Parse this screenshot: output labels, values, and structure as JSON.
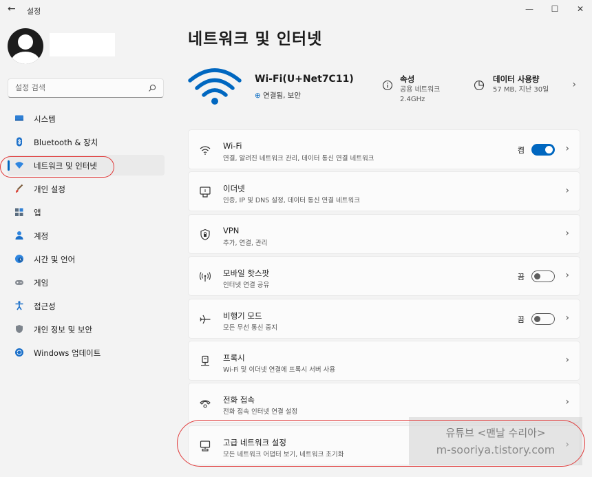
{
  "window": {
    "title": "설정",
    "back_icon": "←",
    "minimize": "—",
    "maximize": "☐",
    "close": "✕"
  },
  "search": {
    "placeholder": "설정 검색"
  },
  "sidebar": {
    "items": [
      {
        "label": "시스템",
        "icon": "monitor-icon"
      },
      {
        "label": "Bluetooth & 장치",
        "icon": "bluetooth-icon"
      },
      {
        "label": "네트워크 및 인터넷",
        "icon": "network-icon",
        "selected": true
      },
      {
        "label": "개인 설정",
        "icon": "brush-icon"
      },
      {
        "label": "앱",
        "icon": "apps-icon"
      },
      {
        "label": "계정",
        "icon": "account-icon"
      },
      {
        "label": "시간 및 언어",
        "icon": "globe-clock-icon"
      },
      {
        "label": "게임",
        "icon": "gamepad-icon"
      },
      {
        "label": "접근성",
        "icon": "accessibility-icon"
      },
      {
        "label": "개인 정보 및 보안",
        "icon": "shield-icon"
      },
      {
        "label": "Windows 업데이트",
        "icon": "update-icon"
      }
    ]
  },
  "page": {
    "title": "네트워크 및 인터넷"
  },
  "hero": {
    "network_name": "Wi-Fi(U+Net7C11)",
    "status": "연결됨, 보안",
    "properties": {
      "title": "속성",
      "line1": "공용 네트워크",
      "line2": "2.4GHz"
    },
    "data_usage": {
      "title": "데이터 사용량",
      "line1": "57 MB, 지난 30일"
    }
  },
  "cards": [
    {
      "title": "Wi-Fi",
      "subtitle": "연결, 알려진 네트워크 관리, 데이터 통신 연결 네트워크",
      "icon": "wifi-icon",
      "state": "켬",
      "toggle": "on"
    },
    {
      "title": "이더넷",
      "subtitle": "인증, IP 및 DNS 설정, 데이터 통신 연결 네트워크",
      "icon": "ethernet-icon"
    },
    {
      "title": "VPN",
      "subtitle": "추가, 연결, 관리",
      "icon": "vpn-shield-icon"
    },
    {
      "title": "모바일 핫스팟",
      "subtitle": "인터넷 연결 공유",
      "icon": "hotspot-icon",
      "state": "끔",
      "toggle": "off"
    },
    {
      "title": "비행기 모드",
      "subtitle": "모든 무선 통신 중지",
      "icon": "airplane-icon",
      "state": "끔",
      "toggle": "off"
    },
    {
      "title": "프록시",
      "subtitle": "Wi-Fi 및 이더넷 연결에 프록시 서버 사용",
      "icon": "proxy-icon"
    },
    {
      "title": "전화 접속",
      "subtitle": "전화 접속 인터넷 연결 설정",
      "icon": "dialup-icon"
    },
    {
      "title": "고급 네트워크 설정",
      "subtitle": "모든 네트워크 어댑터 보기, 네트워크 초기화",
      "icon": "advanced-network-icon"
    }
  ],
  "watermark": {
    "line1": "유튜브 <맨날 수리아>",
    "line2": "m-sooriya.tistory.com"
  },
  "colors": {
    "accent": "#0067c0",
    "annotation": "#e03a3a",
    "background": "#f3f3f3"
  }
}
